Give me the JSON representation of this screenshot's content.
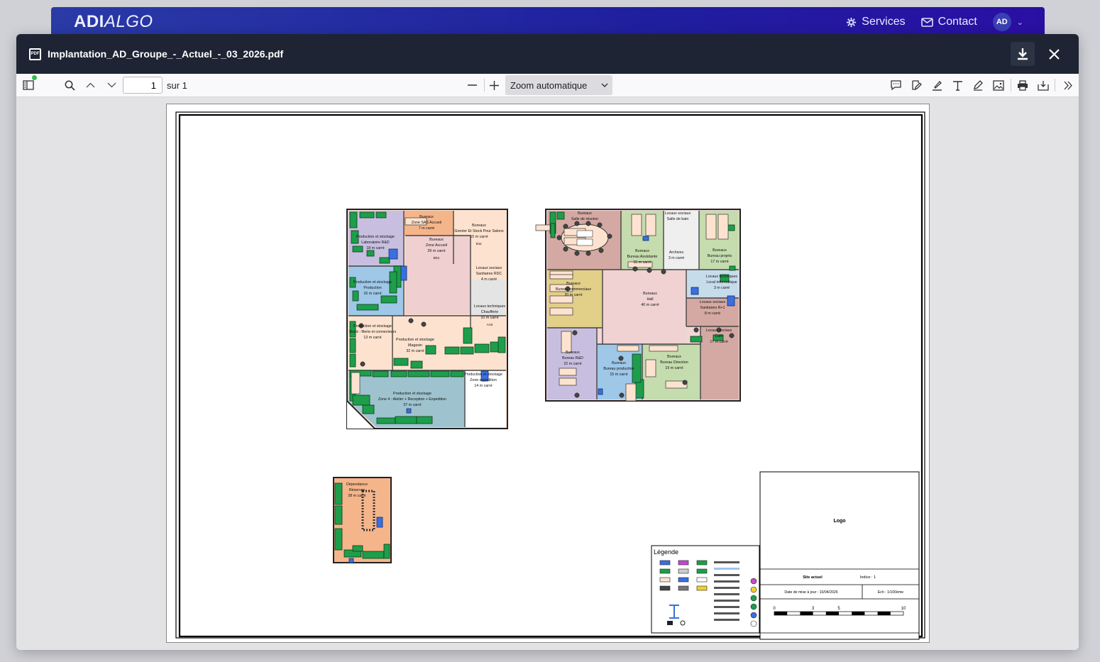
{
  "app": {
    "logo_bold": "ADI",
    "logo_light": "ALGO",
    "nav": {
      "services": "Services",
      "contact": "Contact",
      "avatar": "AD"
    }
  },
  "modal": {
    "title": "Implantation_AD_Groupe_-_Actuel_-_03_2026.pdf",
    "pdf_badge": "PDF"
  },
  "toolbar": {
    "page_value": "1",
    "page_of": "sur 1",
    "zoom": "Zoom automatique"
  },
  "plan": {
    "left_building": [
      {
        "label": "Bureaux",
        "sub": "Zone SAS Accueil",
        "area": "7 m carré"
      },
      {
        "label": "Bureaux",
        "sub": "Grenier Et Stock Pour Salons",
        "area": "15 m carré",
        "code": "B11"
      },
      {
        "label": "Production et stockage",
        "sub": "Laboratoire R&D",
        "area": "18 m carré"
      },
      {
        "label": "Bureaux",
        "sub": "Zone Accueil",
        "area": "29 m carré",
        "code": "B01"
      },
      {
        "label": "Locaux sociaux",
        "sub": "Sanitaires RDC",
        "area": "4 m carré"
      },
      {
        "label": "Production et stockage",
        "sub": "Production",
        "area": "16 m carré"
      },
      {
        "label": "Locaux techniques",
        "sub": "Chaufferie",
        "area": "10 m carré",
        "code": "A15"
      },
      {
        "label": "Production et stockage",
        "sub": "Stock : filerie et connecteurs",
        "area": "13 m carré"
      },
      {
        "label": "Production et stockage",
        "sub": "Magasin",
        "area": "32 m carré"
      },
      {
        "label": "Production et stockage",
        "sub": "Zone 4 : Atelier + Reception + Expedition",
        "area": "37 m carré"
      },
      {
        "label": "Production et stockage",
        "sub": "Zone expedition",
        "area": "14 m carré"
      }
    ],
    "right_building": [
      {
        "label": "Bureaux",
        "sub": "Salle de réunion",
        "area": ""
      },
      {
        "label": "Bureaux",
        "sub": "Bureau Assistante",
        "area": "15 m carré"
      },
      {
        "label": "Locaux sociaux",
        "sub": "Salle de bain",
        "area": ""
      },
      {
        "label": "Archives",
        "sub": "",
        "area": "3 m carré"
      },
      {
        "label": "Bureaux",
        "sub": "Bureau projets",
        "area": "17 m carré"
      },
      {
        "label": "Bureaux",
        "sub": "Bureau commerciaux",
        "area": "20 m carré"
      },
      {
        "label": "Bureaux",
        "sub": "Hall",
        "area": "40 m carré"
      },
      {
        "label": "Locaux techniques",
        "sub": "Local informatique",
        "area": "3 m carré"
      },
      {
        "label": "Locaux sociaux",
        "sub": "Sanitaires R+1",
        "area": "8 m carré"
      },
      {
        "label": "Locaux sociaux",
        "sub": "Café",
        "area": "17 m carré"
      },
      {
        "label": "Bureaux",
        "sub": "Bureau R&D",
        "area": "22 m carré"
      },
      {
        "label": "Bureaux",
        "sub": "Bureau production",
        "area": "15 m carré"
      },
      {
        "label": "Bureaux",
        "sub": "Bureau Direction",
        "area": "19 m carré"
      }
    ],
    "annex": {
      "label": "Dépendance",
      "sub": "Réserves",
      "area": "28 m carré"
    },
    "legend_title": "Légende",
    "cartouche": {
      "logo": "Logo",
      "site": "Site actuel",
      "index": "Indice : 1",
      "date": "Date de mise à jour : 10/04/2026",
      "scale": "Ech : 1/100ème",
      "scale_ticks": [
        "0",
        "3",
        "5",
        "10"
      ]
    }
  },
  "colors": {
    "header_blue": "#1f1f9e",
    "modal_head": "#1e2433",
    "equipment_green": "#1e9e4a"
  }
}
